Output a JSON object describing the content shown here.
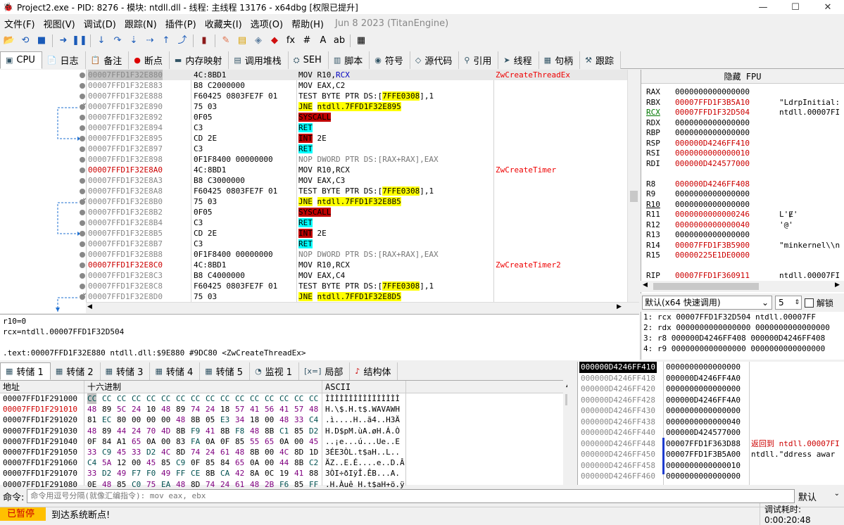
{
  "titlebar": {
    "title": "Project2.exe - PID: 8276 - 模块: ntdll.dll - 线程: 主线程 13176 - x64dbg [权限已提升]",
    "min": "—",
    "max": "☐",
    "close": "✕"
  },
  "menu": {
    "items": [
      "文件(F)",
      "视图(V)",
      "调试(D)",
      "跟踪(N)",
      "插件(P)",
      "收藏夹(I)",
      "选项(O)",
      "帮助(H)"
    ],
    "version": "Jun 8 2023 (TitanEngine)"
  },
  "toolbar": {
    "icons": [
      [
        "open-icon",
        "📂"
      ],
      [
        "restart-icon",
        "⟲"
      ],
      [
        "stop-icon",
        "■"
      ],
      [
        "run-icon",
        "➜"
      ],
      [
        "pause-icon",
        "❚❚"
      ],
      [
        "step-into-icon",
        "↓"
      ],
      [
        "step-over-icon",
        "↷"
      ],
      [
        "trace-into-icon",
        "⇣"
      ],
      [
        "trace-over-icon",
        "⇢"
      ],
      [
        "execute-till-return-icon",
        "↑"
      ],
      [
        "run-to-user-code-icon",
        "⤴"
      ],
      [
        "scylla-icon",
        "▮"
      ],
      [
        "patch-icon",
        "✎"
      ],
      [
        "comment-icon",
        "▤"
      ],
      [
        "label-icon",
        "◈"
      ],
      [
        "bookmark-icon",
        "◆"
      ],
      [
        "function-icon",
        "fx"
      ],
      [
        "hash-icon",
        "#"
      ],
      [
        "font-icon",
        "A"
      ],
      [
        "strings-icon",
        "ab"
      ],
      [
        "calc-icon",
        "▦"
      ]
    ]
  },
  "tabs": [
    [
      "cpu-icon",
      "▣",
      "CPU"
    ],
    [
      "log-icon",
      "📄",
      "日志"
    ],
    [
      "notes-icon",
      "📋",
      "备注"
    ],
    [
      "breakpoint-icon",
      "●",
      "断点"
    ],
    [
      "memory-map-icon",
      "▬",
      "内存映射"
    ],
    [
      "call-stack-icon",
      "▤",
      "调用堆栈"
    ],
    [
      "seh-icon",
      "⛭",
      "SEH"
    ],
    [
      "script-icon",
      "▥",
      "脚本"
    ],
    [
      "symbol-icon",
      "◉",
      "符号"
    ],
    [
      "source-icon",
      "◇",
      "源代码"
    ],
    [
      "references-icon",
      "⚲",
      "引用"
    ],
    [
      "threads-icon",
      "➤",
      "线程"
    ],
    [
      "handles-icon",
      "▦",
      "句柄"
    ],
    [
      "trace-icon",
      "⚒",
      "跟踪"
    ]
  ],
  "cpu": {
    "rows": [
      {
        "addr": "00007FFD1F32E880",
        "addrStyle": "sel",
        "bytes": "4C:8BD1",
        "dis": [
          [
            "MOV R10,",
            ""
          ],
          [
            "RCX",
            "blue"
          ]
        ],
        "cmt": "ZwCreateThreadEx"
      },
      {
        "addr": "00007FFD1F32E883",
        "bytes": "B8 C2000000",
        "dis": [
          [
            "MOV EAX,C2",
            ""
          ]
        ],
        "cmt": ""
      },
      {
        "addr": "00007FFD1F32E888",
        "bytes": "F60425 0803FE7F 01",
        "dis": [
          [
            "TEST BYTE PTR DS:[",
            ""
          ],
          [
            "7FFE0308",
            "hlY"
          ],
          [
            "],1",
            ""
          ]
        ],
        "cmt": ""
      },
      {
        "addr": "00007FFD1F32E890",
        "bytes": "75 03",
        "dis": [
          [
            "JNE",
            "hlY"
          ],
          [
            " ",
            ""
          ],
          [
            "ntdll.7FFD1F32E895",
            "hlY"
          ]
        ],
        "cmt": ""
      },
      {
        "addr": "00007FFD1F32E892",
        "bytes": "0F05",
        "dis": [
          [
            "SYSCALL",
            "hlR"
          ]
        ],
        "cmt": ""
      },
      {
        "addr": "00007FFD1F32E894",
        "bytes": "C3",
        "dis": [
          [
            "RET",
            "hlC"
          ]
        ],
        "cmt": ""
      },
      {
        "addr": "00007FFD1F32E895",
        "bytes": "CD 2E",
        "dis": [
          [
            "INT",
            "hlR"
          ],
          [
            " 2E",
            ""
          ]
        ],
        "cmt": ""
      },
      {
        "addr": "00007FFD1F32E897",
        "bytes": "C3",
        "dis": [
          [
            "RET",
            "hlC"
          ]
        ],
        "cmt": ""
      },
      {
        "addr": "00007FFD1F32E898",
        "bytes": "0F1F8400 00000000",
        "dis": [
          [
            "NOP DWORD PTR DS:[RAX+RAX],EAX",
            "grey"
          ]
        ],
        "cmt": ""
      },
      {
        "addr": "00007FFD1F32E8A0",
        "addrStyle": "hl",
        "bytes": "4C:8BD1",
        "dis": [
          [
            "MOV R10,RCX",
            ""
          ]
        ],
        "cmt": "ZwCreateTimer"
      },
      {
        "addr": "00007FFD1F32E8A3",
        "bytes": "B8 C3000000",
        "dis": [
          [
            "MOV EAX,C3",
            ""
          ]
        ],
        "cmt": ""
      },
      {
        "addr": "00007FFD1F32E8A8",
        "bytes": "F60425 0803FE7F 01",
        "dis": [
          [
            "TEST BYTE PTR DS:[",
            ""
          ],
          [
            "7FFE0308",
            "hlY"
          ],
          [
            "],1",
            ""
          ]
        ],
        "cmt": ""
      },
      {
        "addr": "00007FFD1F32E8B0",
        "bytes": "75 03",
        "dis": [
          [
            "JNE",
            "hlY"
          ],
          [
            " ",
            ""
          ],
          [
            "ntdll.7FFD1F32E8B5",
            "hlY"
          ]
        ],
        "cmt": ""
      },
      {
        "addr": "00007FFD1F32E8B2",
        "bytes": "0F05",
        "dis": [
          [
            "SYSCALL",
            "hlR"
          ]
        ],
        "cmt": ""
      },
      {
        "addr": "00007FFD1F32E8B4",
        "bytes": "C3",
        "dis": [
          [
            "RET",
            "hlC"
          ]
        ],
        "cmt": ""
      },
      {
        "addr": "00007FFD1F32E8B5",
        "bytes": "CD 2E",
        "dis": [
          [
            "INT",
            "hlR"
          ],
          [
            " 2E",
            ""
          ]
        ],
        "cmt": ""
      },
      {
        "addr": "00007FFD1F32E8B7",
        "bytes": "C3",
        "dis": [
          [
            "RET",
            "hlC"
          ]
        ],
        "cmt": ""
      },
      {
        "addr": "00007FFD1F32E8B8",
        "bytes": "0F1F8400 00000000",
        "dis": [
          [
            "NOP DWORD PTR DS:[RAX+RAX],EAX",
            "grey"
          ]
        ],
        "cmt": ""
      },
      {
        "addr": "00007FFD1F32E8C0",
        "addrStyle": "hl",
        "bytes": "4C:8BD1",
        "dis": [
          [
            "MOV R10,RCX",
            ""
          ]
        ],
        "cmt": "ZwCreateTimer2"
      },
      {
        "addr": "00007FFD1F32E8C3",
        "bytes": "B8 C4000000",
        "dis": [
          [
            "MOV EAX,C4",
            ""
          ]
        ],
        "cmt": ""
      },
      {
        "addr": "00007FFD1F32E8C8",
        "bytes": "F60425 0803FE7F 01",
        "dis": [
          [
            "TEST BYTE PTR DS:[",
            ""
          ],
          [
            "7FFE0308",
            "hlY"
          ],
          [
            "],1",
            ""
          ]
        ],
        "cmt": ""
      },
      {
        "addr": "00007FFD1F32E8D0",
        "bytes": "75 03",
        "dis": [
          [
            "JNE",
            "hlY"
          ],
          [
            " ",
            ""
          ],
          [
            "ntdll.7FFD1F32E8D5",
            "hlY"
          ]
        ],
        "cmt": ""
      }
    ]
  },
  "regs": {
    "header": "隐藏 FPU",
    "rows": [
      {
        "n": "RAX",
        "v": "0000000000000000",
        "c": ""
      },
      {
        "n": "RBX",
        "v": "00007FFD1F3B5A10",
        "c": "\"LdrpInitial:",
        "chg": true
      },
      {
        "n": "RCX",
        "v": "00007FFD1F32D504",
        "c": "ntdll.00007FI",
        "chg": true
      },
      {
        "n": "RDX",
        "v": "0000000000000000",
        "c": ""
      },
      {
        "n": "RBP",
        "v": "0000000000000000",
        "c": ""
      },
      {
        "n": "RSP",
        "v": "000000D4246FF410",
        "c": "",
        "chg": true
      },
      {
        "n": "RSI",
        "v": "0000000000000010",
        "c": "",
        "chg": true
      },
      {
        "n": "RDI",
        "v": "000000D424577000",
        "c": "",
        "chg": true
      },
      {
        "n": "",
        "v": "",
        "c": ""
      },
      {
        "n": "R8",
        "v": "000000D4246FF408",
        "c": "",
        "chg": true
      },
      {
        "n": "R9",
        "v": "0000000000000000",
        "c": ""
      },
      {
        "n": "R10",
        "v": "0000000000000000",
        "c": ""
      },
      {
        "n": "R11",
        "v": "0000000000000246",
        "c": "L'Ɇ'",
        "chg": true
      },
      {
        "n": "R12",
        "v": "0000000000000040",
        "c": "'@'",
        "chg": true
      },
      {
        "n": "R13",
        "v": "0000000000000000",
        "c": ""
      },
      {
        "n": "R14",
        "v": "00007FFD1F3B5900",
        "c": "\"minkernel\\\\n",
        "chg": true
      },
      {
        "n": "R15",
        "v": "00000225E1DE0000",
        "c": "",
        "chg": true
      },
      {
        "n": "",
        "v": "",
        "c": ""
      },
      {
        "n": "RIP",
        "v": "00007FFD1F360911",
        "c": "ntdll.00007FI",
        "chg": true
      }
    ]
  },
  "callconv": {
    "value": "默认(x64 快速调用)",
    "count": "5",
    "unlock": "解锁"
  },
  "args": [
    "1: rcx 00007FFD1F32D504 ntdll.00007FF",
    "2: rdx 0000000000000000 0000000000000000",
    "3: r8 000000D4246FF408 000000D4246FF408",
    "4: r9 0000000000000000 0000000000000000"
  ],
  "info": {
    "lines": [
      "r10=0",
      "rcx=ntdll.00007FFD1F32D504",
      "",
      ".text:00007FFD1F32E880 ntdll.dll:$9E880 #9DC80 <ZwCreateThreadEx>"
    ]
  },
  "btabs": [
    [
      "dump-icon",
      "▦",
      "转储 1"
    ],
    [
      "dump-icon",
      "▦",
      "转储 2"
    ],
    [
      "dump-icon",
      "▦",
      "转储 3"
    ],
    [
      "dump-icon",
      "▦",
      "转储 4"
    ],
    [
      "dump-icon",
      "▦",
      "转储 5"
    ],
    [
      "watch-icon",
      "◔",
      "监视 1"
    ],
    [
      "locals-icon",
      "[x=]",
      "局部"
    ],
    [
      "struct-icon",
      "♪",
      "结构体"
    ]
  ],
  "dump": {
    "headers": {
      "addr": "地址",
      "hex": "十六进制",
      "ascii": "ASCII"
    },
    "rows": [
      {
        "a": "00007FFD1F291000",
        "h": [
          "CC",
          "CC",
          "CC",
          "CC",
          "CC",
          "CC",
          "CC",
          "CC",
          "CC",
          "CC",
          "CC",
          "CC",
          "CC",
          "CC",
          "CC",
          "CC"
        ],
        "s": "ÌÌÌÌÌÌÌÌÌÌÌÌÌÌÌÌ",
        "first": true
      },
      {
        "a": "00007FFD1F291010",
        "h": [
          "48",
          "89",
          "5C",
          "24",
          "10",
          "48",
          "89",
          "74",
          "24",
          "18",
          "57",
          "41",
          "56",
          "41",
          "57",
          "48"
        ],
        "s": "H.\\$.H.t$.WAVAWH",
        "hl": true
      },
      {
        "a": "00007FFD1F291020",
        "h": [
          "81",
          "EC",
          "80",
          "00",
          "00",
          "00",
          "48",
          "8B",
          "05",
          "E3",
          "34",
          "18",
          "00",
          "48",
          "33",
          "C4"
        ],
        "s": ".ì....H..ã4..H3Ä"
      },
      {
        "a": "00007FFD1F291030",
        "h": [
          "48",
          "89",
          "44",
          "24",
          "70",
          "4D",
          "8B",
          "F9",
          "41",
          "8B",
          "F8",
          "48",
          "8B",
          "C1",
          "85",
          "D2"
        ],
        "s": "H.D$pM.ùA.øH.Á.Ò"
      },
      {
        "a": "00007FFD1F291040",
        "h": [
          "0F",
          "84",
          "A1",
          "65",
          "0A",
          "00",
          "83",
          "FA",
          "0A",
          "0F",
          "85",
          "55",
          "65",
          "0A",
          "00",
          "45"
        ],
        "s": "..¡e...ú...Ue..E"
      },
      {
        "a": "00007FFD1F291050",
        "h": [
          "33",
          "C9",
          "45",
          "33",
          "D2",
          "4C",
          "8D",
          "74",
          "24",
          "61",
          "48",
          "8B",
          "00",
          "4C",
          "8D",
          "1D"
        ],
        "s": "3ÉE3ÒL.t$aH..L.."
      },
      {
        "a": "00007FFD1F291060",
        "h": [
          "C4",
          "5A",
          "12",
          "00",
          "45",
          "85",
          "C9",
          "0F",
          "85",
          "84",
          "65",
          "0A",
          "00",
          "44",
          "8B",
          "C2"
        ],
        "s": "ÄZ..E.É....e..D.Â"
      },
      {
        "a": "00007FFD1F291070",
        "h": [
          "33",
          "D2",
          "49",
          "F7",
          "F0",
          "49",
          "FF",
          "CE",
          "8B",
          "CA",
          "42",
          "8A",
          "0C",
          "19",
          "41",
          "88"
        ],
        "s": "3ÒI÷ðIÿÎ.ÊB...A."
      },
      {
        "a": "00007FFD1F291080",
        "h": [
          "0E",
          "48",
          "85",
          "C0",
          "75",
          "EA",
          "48",
          "8D",
          "74",
          "24",
          "61",
          "48",
          "2B",
          "F6",
          "85",
          "FF"
        ],
        "s": ".H.Àuê H.t$aH+ö.ÿ"
      }
    ]
  },
  "stack": {
    "rows": [
      {
        "a": "000000D4246FF410",
        "v": "0000000000000000",
        "x": "",
        "cur": true
      },
      {
        "a": "000000D4246FF418",
        "v": "000000D4246FF4A0",
        "x": ""
      },
      {
        "a": "000000D4246FF420",
        "v": "0000000000000000",
        "x": ""
      },
      {
        "a": "000000D4246FF428",
        "v": "000000D4246FF4A0",
        "x": ""
      },
      {
        "a": "000000D4246FF430",
        "v": "0000000000000000",
        "x": ""
      },
      {
        "a": "000000D4246FF438",
        "v": "0000000000000040",
        "x": ""
      },
      {
        "a": "000000D4246FF440",
        "v": "000000D424577000",
        "x": ""
      },
      {
        "a": "000000D4246FF448",
        "v": "00007FFD1F363D88",
        "x": "返回到 ntdll.00007FI",
        "ret": true
      },
      {
        "a": "000000D4246FF450",
        "v": "00007FFD1F3B5A00",
        "x": "ntdll.\"ddress awar"
      },
      {
        "a": "000000D4246FF458",
        "v": "0000000000000010",
        "x": ""
      },
      {
        "a": "000000D4246FF460",
        "v": "0000000000000000",
        "x": ""
      }
    ]
  },
  "cmd": {
    "label": "命令:",
    "placeholder": "命令用逗号分隔(就像汇编指令): mov eax, ebx",
    "default": "默认"
  },
  "status": {
    "state": "已暂停",
    "message": "到达系统断点!",
    "time": "调试耗时: 0:00:20:48"
  }
}
